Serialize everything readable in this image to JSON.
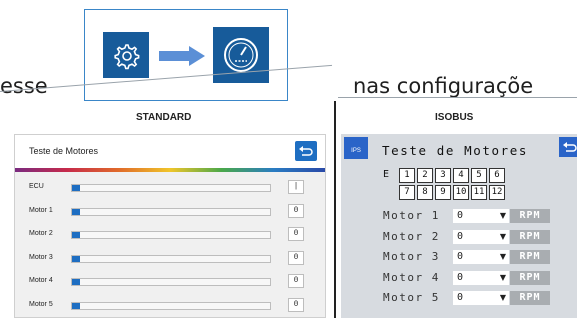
{
  "caption": {
    "left": "esse",
    "right": "nas configuraçõe"
  },
  "sections": {
    "standard": "STANDARD",
    "isobus": "ISOBUS"
  },
  "standard": {
    "title": "Teste de Motores",
    "rows": [
      {
        "label": "ECU",
        "fill": 0.04,
        "value": "|"
      },
      {
        "label": "Motor 1",
        "fill": 0.04,
        "value": "0"
      },
      {
        "label": "Motor 2",
        "fill": 0.04,
        "value": "0"
      },
      {
        "label": "Motor 3",
        "fill": 0.04,
        "value": "0"
      },
      {
        "label": "Motor 4",
        "fill": 0.04,
        "value": "0"
      },
      {
        "label": "Motor 5",
        "fill": 0.04,
        "value": "0"
      }
    ],
    "accent": "#1e6ec2"
  },
  "isobus": {
    "ips_label": "IPS",
    "title": "Teste de Motores",
    "ecu_label": "E",
    "ecu_row1": [
      "1",
      "2",
      "3",
      "4",
      "5",
      "6"
    ],
    "ecu_row2": [
      "7",
      "8",
      "9",
      "10",
      "11",
      "12"
    ],
    "rows": [
      {
        "label": "Motor 1",
        "value": "0",
        "unit": "RPM"
      },
      {
        "label": "Motor 2",
        "value": "0",
        "unit": "RPM"
      },
      {
        "label": "Motor 3",
        "value": "0",
        "unit": "RPM"
      },
      {
        "label": "Motor 4",
        "value": "0",
        "unit": "RPM"
      },
      {
        "label": "Motor 5",
        "value": "0",
        "unit": "RPM"
      }
    ],
    "accent": "#2a64c8"
  },
  "icons": {
    "settings": "gear-icon",
    "arrow": "arrow-right-icon",
    "gauge": "gauge-icon",
    "back": "back-arrow-icon"
  }
}
